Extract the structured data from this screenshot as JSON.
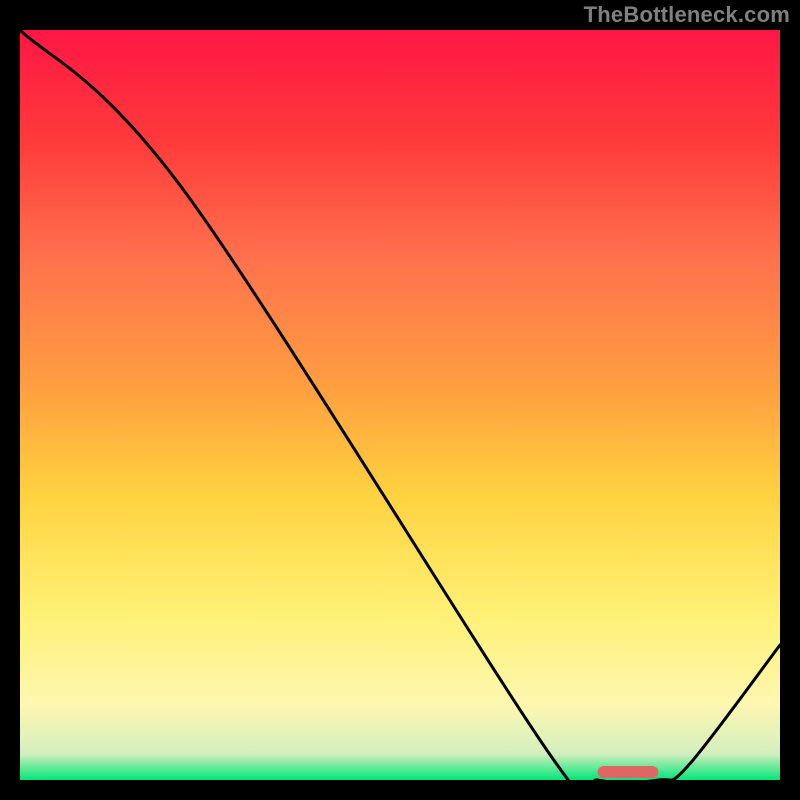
{
  "watermark": "TheBottleneck.com",
  "chart_data": {
    "type": "line",
    "title": "",
    "xlabel": "",
    "ylabel": "",
    "xlim": [
      0,
      100
    ],
    "ylim": [
      0,
      100
    ],
    "x": [
      0,
      22,
      70,
      76,
      84,
      88,
      100
    ],
    "values": [
      100,
      78,
      3,
      0,
      0,
      2,
      18
    ],
    "marker": {
      "x_start": 76,
      "x_end": 84,
      "color": "#e06666"
    },
    "gradient_stops": [
      {
        "offset": 0.0,
        "color": "#ff1744"
      },
      {
        "offset": 0.15,
        "color": "#ff3b3b"
      },
      {
        "offset": 0.3,
        "color": "#ff704d"
      },
      {
        "offset": 0.48,
        "color": "#ffa040"
      },
      {
        "offset": 0.62,
        "color": "#ffd23f"
      },
      {
        "offset": 0.78,
        "color": "#fff176"
      },
      {
        "offset": 0.9,
        "color": "#fdf7b0"
      },
      {
        "offset": 0.965,
        "color": "#d4eebf"
      },
      {
        "offset": 1.0,
        "color": "#00e676"
      }
    ]
  }
}
